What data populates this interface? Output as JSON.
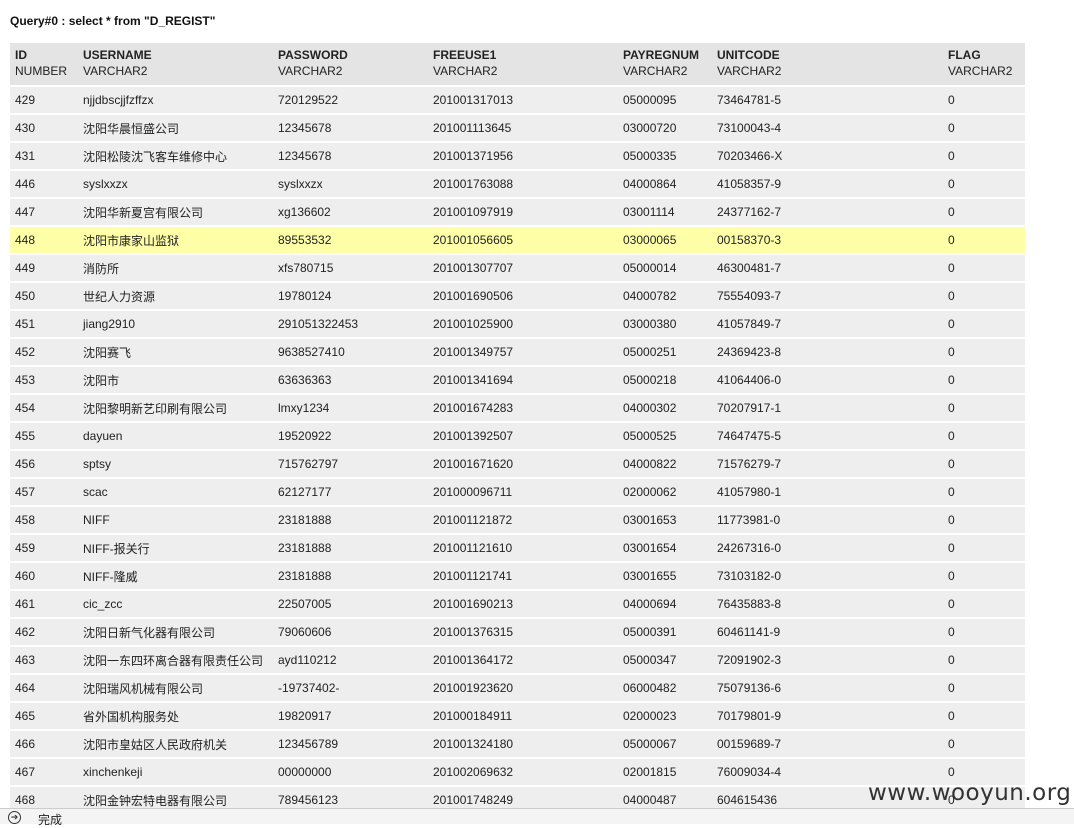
{
  "query": {
    "title": "Query#0 : select * from \"D_REGIST\""
  },
  "columns": [
    {
      "name": "ID",
      "type": "NUMBER"
    },
    {
      "name": "USERNAME",
      "type": "VARCHAR2"
    },
    {
      "name": "PASSWORD",
      "type": "VARCHAR2"
    },
    {
      "name": "FREEUSE1",
      "type": "VARCHAR2"
    },
    {
      "name": "PAYREGNUM",
      "type": "VARCHAR2"
    },
    {
      "name": "UNITCODE",
      "type": "VARCHAR2"
    },
    {
      "name": "FLAG",
      "type": "VARCHAR2"
    }
  ],
  "rows": [
    [
      "429",
      "njjdbscjjfzffzx",
      "720129522",
      "201001317013",
      "05000095",
      "73464781-5",
      "0"
    ],
    [
      "430",
      "沈阳华晨恒盛公司",
      "12345678",
      "201001113645",
      "03000720",
      "73100043-4",
      "0"
    ],
    [
      "431",
      "沈阳松陵沈飞客车维修中心",
      "12345678",
      "201001371956",
      "05000335",
      "70203466-X",
      "0"
    ],
    [
      "446",
      "syslxxzx",
      "syslxxzx",
      "201001763088",
      "04000864",
      "41058357-9",
      "0"
    ],
    [
      "447",
      "沈阳华新夏宫有限公司",
      "xg136602",
      "201001097919",
      "03001114",
      "24377162-7",
      "0"
    ],
    [
      "448",
      "沈阳市康家山监狱",
      "89553532",
      "201001056605",
      "03000065",
      "00158370-3",
      "0"
    ],
    [
      "449",
      "消防所",
      "xfs780715",
      "201001307707",
      "05000014",
      "46300481-7",
      "0"
    ],
    [
      "450",
      "世纪人力资源",
      "19780124",
      "201001690506",
      "04000782",
      "75554093-7",
      "0"
    ],
    [
      "451",
      "jiang2910",
      "291051322453",
      "201001025900",
      "03000380",
      "41057849-7",
      "0"
    ],
    [
      "452",
      "沈阳赛飞",
      "9638527410",
      "201001349757",
      "05000251",
      "24369423-8",
      "0"
    ],
    [
      "453",
      "沈阳市",
      "63636363",
      "201001341694",
      "05000218",
      "41064406-0",
      "0"
    ],
    [
      "454",
      "沈阳黎明新艺印刷有限公司",
      "lmxy1234",
      "201001674283",
      "04000302",
      "70207917-1",
      "0"
    ],
    [
      "455",
      "dayuen",
      "19520922",
      "201001392507",
      "05000525",
      "74647475-5",
      "0"
    ],
    [
      "456",
      "sptsy",
      "715762797",
      "201001671620",
      "04000822",
      "71576279-7",
      "0"
    ],
    [
      "457",
      "scac",
      "62127177",
      "201000096711",
      "02000062",
      "41057980-1",
      "0"
    ],
    [
      "458",
      "NIFF",
      "23181888",
      "201001121872",
      "03001653",
      "11773981-0",
      "0"
    ],
    [
      "459",
      "NIFF-报关行",
      "23181888",
      "201001121610",
      "03001654",
      "24267316-0",
      "0"
    ],
    [
      "460",
      "NIFF-隆威",
      "23181888",
      "201001121741",
      "03001655",
      "73103182-0",
      "0"
    ],
    [
      "461",
      "cic_zcc",
      "22507005",
      "201001690213",
      "04000694",
      "76435883-8",
      "0"
    ],
    [
      "462",
      "沈阳日新气化器有限公司",
      "79060606",
      "201001376315",
      "05000391",
      "60461141-9",
      "0"
    ],
    [
      "463",
      "沈阳一东四环离合器有限责任公司",
      "ayd110212",
      "201001364172",
      "05000347",
      "72091902-3",
      "0"
    ],
    [
      "464",
      "沈阳瑞风机械有限公司",
      "-19737402-",
      "201001923620",
      "06000482",
      "75079136-6",
      "0"
    ],
    [
      "465",
      "省外国机构服务处",
      "19820917",
      "201000184911",
      "02000023",
      "70179801-9",
      "0"
    ],
    [
      "466",
      "沈阳市皇姑区人民政府机关",
      "123456789",
      "201001324180",
      "05000067",
      "00159689-7",
      "0"
    ],
    [
      "467",
      "xinchenkeji",
      "00000000",
      "201002069632",
      "02001815",
      "76009034-4",
      "0"
    ],
    [
      "468",
      "沈阳金钟宏特电器有限公司",
      "789456123",
      "201001748249",
      "04000487",
      "604615436",
      "0"
    ]
  ],
  "highlighted_row": 5,
  "watermark": "www.wooyun.org",
  "status": {
    "text": "完成",
    "icon": "arrow-right-icon"
  },
  "colors": {
    "header_bg": "#e4e4e4",
    "row_bg": "#eeeeee",
    "highlight_bg": "#ffffa8"
  }
}
